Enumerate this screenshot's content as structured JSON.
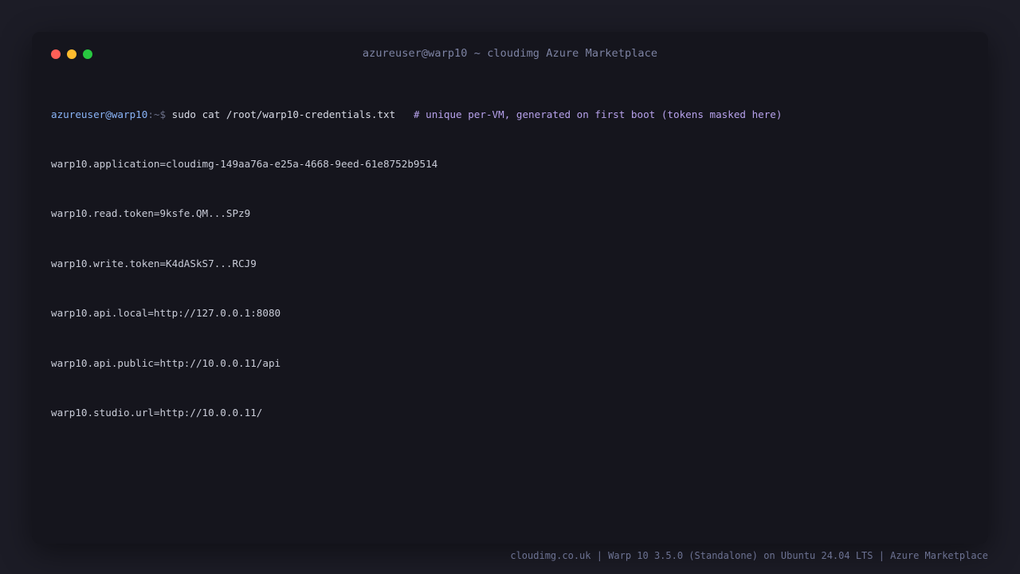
{
  "window": {
    "title": "azureuser@warp10 ~ cloudimg Azure Marketplace"
  },
  "terminal": {
    "prompt_user": "azureuser@warp10",
    "prompt_sep": ":~$",
    "command": "sudo cat /root/warp10-credentials.txt",
    "comment": "# unique per-VM, generated on first boot (tokens masked here)",
    "output": [
      "warp10.application=cloudimg-149aa76a-e25a-4668-9eed-61e8752b9514",
      "warp10.read.token=9ksfe.QM...SPz9",
      "warp10.write.token=K4dASkS7...RCJ9",
      "warp10.api.local=http://127.0.0.1:8080",
      "warp10.api.public=http://10.0.0.11/api",
      "warp10.studio.url=http://10.0.0.11/"
    ]
  },
  "footer": {
    "text": "cloudimg.co.uk | Warp 10 3.5.0 (Standalone) on Ubuntu 24.04 LTS | Azure Marketplace"
  },
  "colors": {
    "close": "#ff5f57",
    "minimize": "#febc2e",
    "maximize": "#28c840"
  }
}
